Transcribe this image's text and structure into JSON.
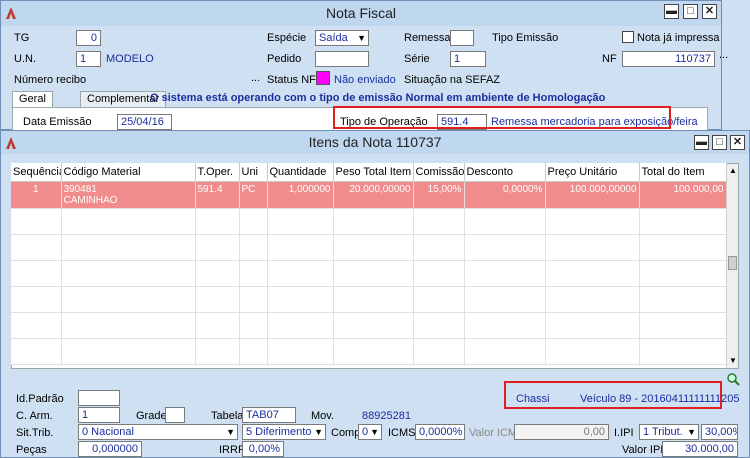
{
  "back_window": {
    "title": "Nota Fiscal",
    "tg_label": "TG",
    "tg_value": "0",
    "un_label": "U.N.",
    "un_value": "1",
    "un_name": "MODELO",
    "numero_recibo_label": "Número recibo",
    "ellipsis": "...",
    "especie_label": "Espécie",
    "especie_value": "Saída",
    "pedido_label": "Pedido",
    "status_nfe_label": "Status NFe",
    "status_nfe_value": "Não enviado",
    "remessa_label": "Remessa",
    "serie_label": "Série",
    "serie_value": "1",
    "situacao_label": "Situação na SEFAZ",
    "tipo_emissao_label": "Tipo Emissão",
    "nota_impressa_label": "Nota já impressa",
    "nf_label": "NF",
    "nf_value": "110737",
    "tabs": [
      "Geral",
      "Complementar"
    ],
    "homolog_message": "O sistema está operando com o tipo de emissão Normal em ambiente de Homologação",
    "data_emissao_label": "Data Emissão",
    "data_emissao_value": "25/04/16",
    "tipo_operacao_label": "Tipo de Operação",
    "tipo_operacao_value": "591.4",
    "tipo_operacao_desc": "Remessa mercadoria para exposição/feira",
    "status_color": "#ff00ff"
  },
  "items_window": {
    "title": "Itens da Nota 110737",
    "columns": [
      "Sequência",
      "Código Material",
      "T.Oper.",
      "Uni",
      "Quantidade",
      "Peso Total Item",
      "Comissão",
      "Desconto",
      "Preço Unitário",
      "Total do Item"
    ],
    "rows": [
      {
        "seq": "1",
        "codigo": "390481",
        "descricao": "CAMINHAO",
        "toper": "591.4",
        "uni": "PC",
        "quantidade": "1,000000",
        "peso": "20.000,00000",
        "comissao": "15,00%",
        "desconto": "0,0000%",
        "preco": "100.000,00000",
        "total": "100.000,00"
      }
    ],
    "selected_row_color": "#f08c8c"
  },
  "form": {
    "id_padrao_label": "Id.Padrão",
    "c_arm_label": "C. Arm.",
    "c_arm_value": "1",
    "grade_label": "Grade",
    "tabela_label": "Tabela",
    "tabela_value": "TAB07",
    "mov_label": "Mov.",
    "mov_value": "88925281",
    "chassi_label": "Chassi",
    "chassi_value": "Veículo 89 - 20160411111111205",
    "sit_trib_label": "Sit.Trib.",
    "sit_trib_value": "0 Nacional",
    "sit_trib2_value": "5 Diferimento",
    "compl_label": "Compl",
    "compl_value": "0",
    "icms_label": "ICMS",
    "icms_value": "0,0000%",
    "valor_icms_label": "Valor ICMS",
    "valor_icms_value": "0,00",
    "ipi_label": "I.IPI",
    "ipi_value": "1 Tribut.",
    "ipi_percent": "30,00%",
    "pecas_label": "Peças",
    "pecas_value": "0,000000",
    "irrf_label": "IRRF",
    "irrf_value": "0,00%",
    "valor_ipi_label": "Valor IPI",
    "valor_ipi_value": "30.000,00"
  }
}
